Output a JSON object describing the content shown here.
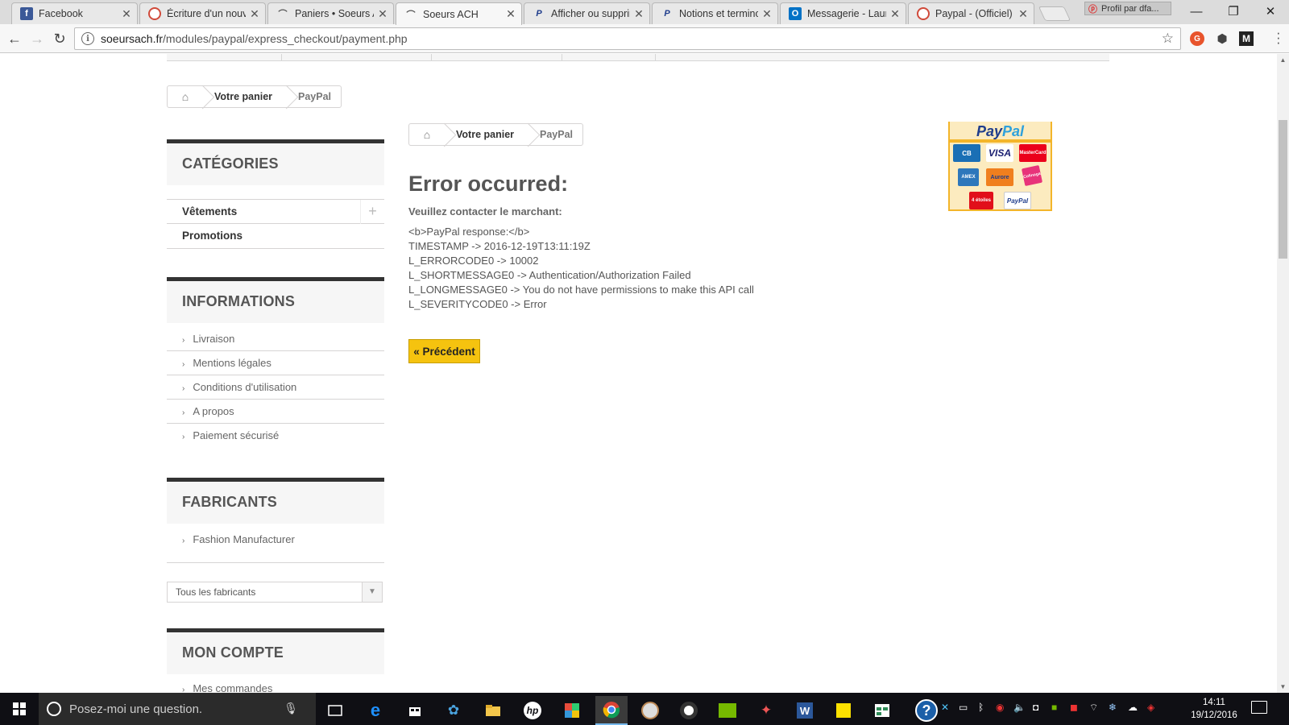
{
  "browser": {
    "tabs": [
      {
        "label": "Facebook",
        "favicon": "facebook-icon",
        "color": "#3b5998"
      },
      {
        "label": "Écriture d'un nouv",
        "favicon": "pie-icon",
        "color": "#d04a3a"
      },
      {
        "label": "Paniers • Soeurs AC",
        "favicon": "prestashop-icon",
        "color": "#555555"
      },
      {
        "label": "Soeurs ACH",
        "favicon": "prestashop-icon",
        "color": "#555555",
        "active": true
      },
      {
        "label": "Afficher ou supprim",
        "favicon": "paypal-icon",
        "color": "#1f3d8c"
      },
      {
        "label": "Notions et termino",
        "favicon": "paypal-icon",
        "color": "#1f3d8c"
      },
      {
        "label": "Messagerie - Laura",
        "favicon": "outlook-icon",
        "color": "#0072c6"
      },
      {
        "label": "Paypal - (Officiel)",
        "favicon": "pie-icon",
        "color": "#d04a3a"
      }
    ],
    "profile_label": "Profil par dfa...",
    "url_host": "soeursach.fr",
    "url_path": "/modules/paypal/express_checkout/payment.php",
    "extension_m": "M"
  },
  "page": {
    "breadcrumb": {
      "cart": "Votre panier",
      "current": "PayPal"
    },
    "sidebar": {
      "categories_title": "CATÉGORIES",
      "categories": [
        {
          "label": "Vêtements",
          "expandable": true
        },
        {
          "label": "Promotions",
          "expandable": false
        }
      ],
      "informations_title": "INFORMATIONS",
      "informations": [
        {
          "label": "Livraison"
        },
        {
          "label": "Mentions légales"
        },
        {
          "label": "Conditions d'utilisation"
        },
        {
          "label": "A propos"
        },
        {
          "label": "Paiement sécurisé"
        }
      ],
      "manufacturers_title": "FABRICANTS",
      "manufacturers": [
        {
          "label": "Fashion Manufacturer"
        }
      ],
      "manufacturers_select": "Tous les fabricants",
      "account_title": "MON COMPTE",
      "account_first_item": "Mes commandes"
    },
    "main": {
      "error_title": "Error occurred:",
      "contact_text": "Veuillez contacter le marchant:",
      "response_lines": [
        "<b>PayPal response:</b>",
        "TIMESTAMP -> 2016-12-19T13:11:19Z",
        "L_ERRORCODE0 -> 10002",
        "L_SHORTMESSAGE0 -> Authentication/Authorization Failed",
        "L_LONGMESSAGE0 -> You do not have permissions to make this API call",
        "L_SEVERITYCODE0 -> Error"
      ],
      "back_button": "« Précédent"
    },
    "paypal_logo": {
      "title_a": "Pay",
      "title_b": "Pal",
      "cards": [
        {
          "label": "CB",
          "color": "#1a6fb5"
        },
        {
          "label": "VISA",
          "color": "#1a1f71"
        },
        {
          "label": "MasterCard",
          "color": "#eb001b"
        },
        {
          "label": "AMEX",
          "color": "#2e77bb"
        },
        {
          "label": "Aurore",
          "color": "#f07f1e"
        },
        {
          "label": "Cofinoga",
          "color": "#e8337a"
        },
        {
          "label": "4 étoiles",
          "color": "#e10f1a"
        },
        {
          "label": "PayPal",
          "color": "#ffffff"
        }
      ]
    }
  },
  "taskbar": {
    "search_placeholder": "Posez-moi une question.",
    "time": "14:11",
    "date": "19/12/2016"
  }
}
